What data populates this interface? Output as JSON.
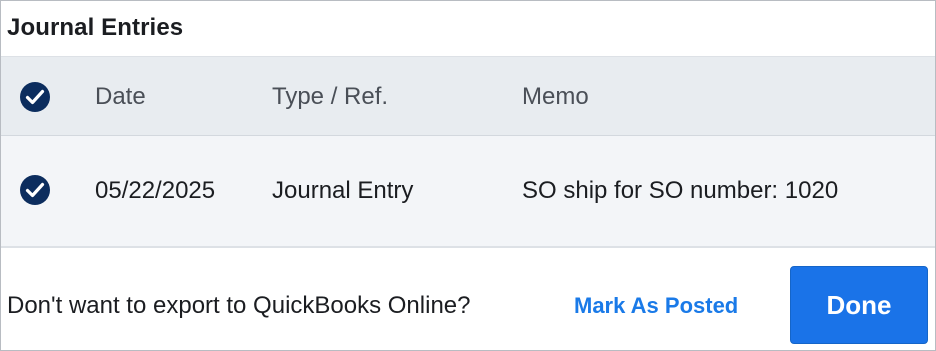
{
  "header": {
    "title": "Journal Entries"
  },
  "table": {
    "columns": [
      "Date",
      "Type / Ref.",
      "Memo"
    ],
    "select_all_checked": true,
    "rows": [
      {
        "checked": true,
        "date": "05/22/2025",
        "type": "Journal Entry",
        "memo": "SO ship for SO number: 1020"
      }
    ]
  },
  "footer": {
    "prompt": "Don't want to export to QuickBooks Online?",
    "mark_as_posted_label": "Mark As Posted",
    "done_label": "Done"
  },
  "icons": {
    "checkbox": "check-circle-icon"
  },
  "colors": {
    "check_fill": "#0c2d5e",
    "link": "#1a7ae8",
    "button": "#1a73e8",
    "header_bg": "#e8ecf0",
    "row_bg": "#f3f5f8"
  }
}
